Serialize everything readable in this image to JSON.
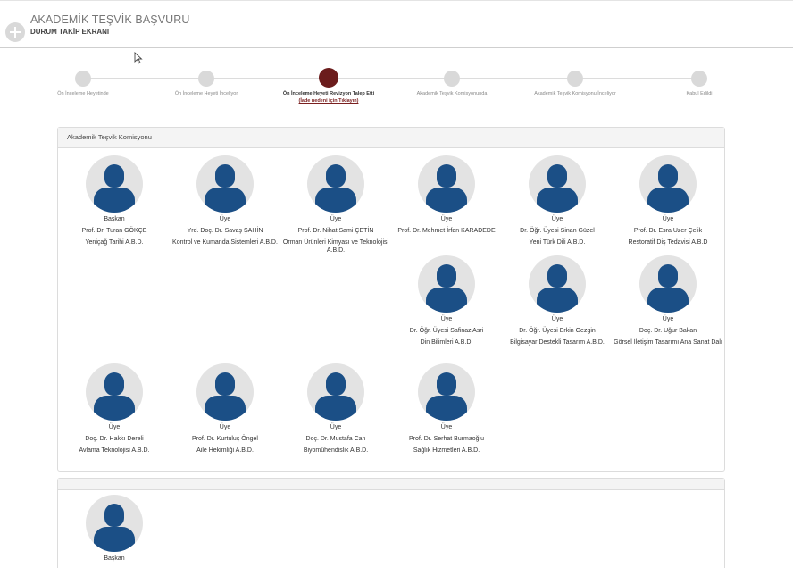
{
  "header": {
    "title": "AKADEMİK TEŞVİK BAŞVURU",
    "subtitle": "DURUM TAKİP EKRANI"
  },
  "stepper": {
    "steps": [
      {
        "label": "Ön İnceleme Heyetinde",
        "active": false
      },
      {
        "label": "Ön İnceleme Heyeti İnceliyor",
        "active": false
      },
      {
        "label": "Ön İnceleme Heyeti Revizyon Talep Etti",
        "active": true,
        "link": "(İade nedeni için Tıklayın)"
      },
      {
        "label": "Akademik Teşvik Komisyonunda",
        "active": false
      },
      {
        "label": "Akademik Teşvik Komisyonu İnceliyor",
        "active": false
      },
      {
        "label": "Kabul Edildi",
        "active": false
      }
    ]
  },
  "committee": {
    "title": "Akademik Teşvik Komisyonu",
    "members": [
      {
        "role": "Başkan",
        "name": "Prof. Dr. Turan GÖKÇE",
        "dept": "Yeniçağ Tarihi A.B.D."
      },
      {
        "role": "Üye",
        "name": "Yrd. Doç. Dr. Savaş ŞAHİN",
        "dept": "Kontrol ve Kumanda Sistemleri A.B.D."
      },
      {
        "role": "Üye",
        "name": "Prof. Dr. Nihat Sami ÇETİN",
        "dept": "Orman Ürünleri Kimyası ve Teknolojisi A.B.D."
      },
      {
        "role": "Üye",
        "name": "Prof. Dr. Mehmet İrfan KARADEDE",
        "dept": ""
      },
      {
        "role": "Üye",
        "name": "Dr. Öğr. Üyesi Sinan Güzel",
        "dept": "Yeni Türk Dili A.B.D."
      },
      {
        "role": "Üye",
        "name": "Prof. Dr. Esra Uzer Çelik",
        "dept": "Restoratif Diş Tedavisi A.B.D"
      },
      {
        "role": "Üye",
        "name": "Dr. Öğr. Üyesi Safinaz Asri",
        "dept": "Din Bilimleri A.B.D."
      },
      {
        "role": "Üye",
        "name": "Dr. Öğr. Üyesi Erkin Gezgin",
        "dept": "Bilgisayar Destekli Tasarım A.B.D."
      },
      {
        "role": "Üye",
        "name": "Doç. Dr. Uğur Bakan",
        "dept": "Görsel İletişim Tasarımı Ana Sanat Dalı"
      },
      {
        "role": "Üye",
        "name": "Doç. Dr. Hakkı Dereli",
        "dept": "Avlama Teknolojisi A.B.D."
      },
      {
        "role": "Üye",
        "name": "Prof. Dr. Kurtuluş Öngel",
        "dept": "Aile Hekimliği A.B.D."
      },
      {
        "role": "Üye",
        "name": "Doç. Dr. Mustafa Can",
        "dept": "Biyomühendislik A.B.D."
      },
      {
        "role": "Üye",
        "name": "Prof. Dr. Serhat Burmaoğlu",
        "dept": "Sağlık Hizmetleri A.B.D."
      }
    ]
  },
  "second_panel": {
    "title": "",
    "members": [
      {
        "role": "Başkan"
      }
    ]
  },
  "colors": {
    "active_step": "#6b1c1c",
    "avatar_figure": "#1b4f86",
    "avatar_bg": "#e3e3e3"
  }
}
